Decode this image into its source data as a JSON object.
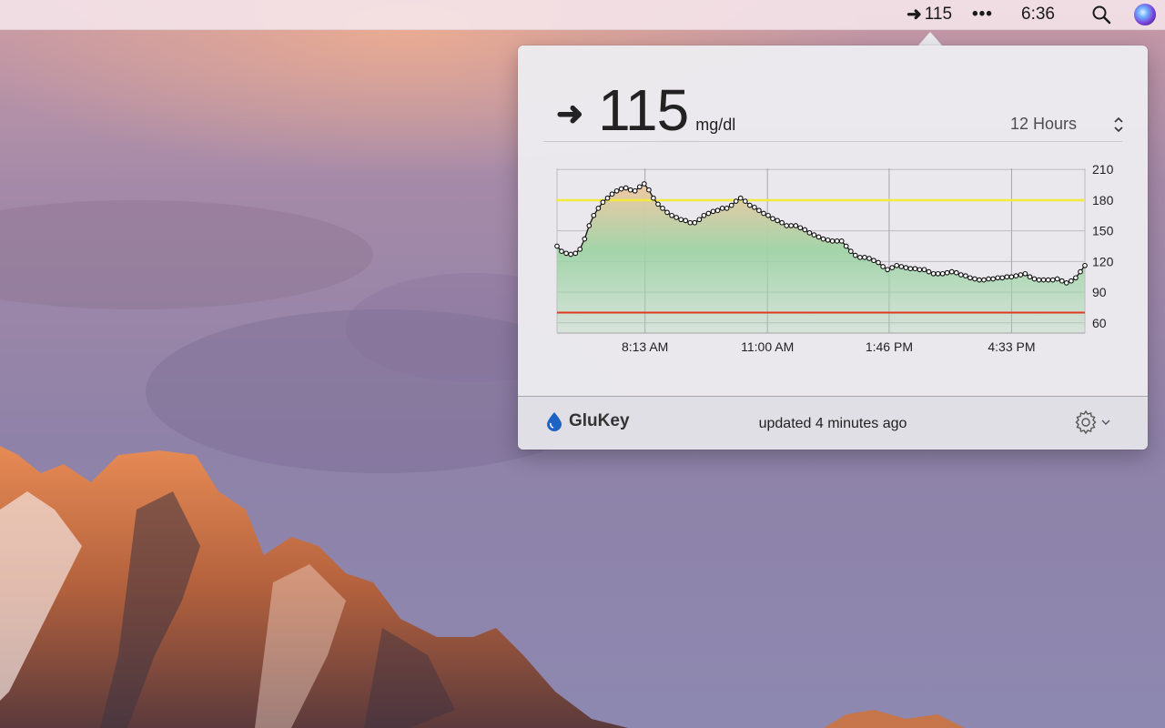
{
  "menubar": {
    "glucose_arrow": "➜",
    "glucose_value": "115",
    "more_label": "•••",
    "clock": "6:36",
    "icons": [
      "search-icon",
      "siri-icon"
    ]
  },
  "popover": {
    "trend_arrow": "➜",
    "value": "115",
    "unit": "mg/dl",
    "range_label": "12 Hours",
    "brand": "GluKey",
    "status": "updated 4 minutes ago"
  },
  "colors": {
    "high_threshold": "#f2ea3c",
    "low_threshold": "#e23a1e",
    "fill_top": "#f2c7a0",
    "fill_bottom": "#9fd3a6"
  },
  "chart_data": {
    "type": "line",
    "title": "",
    "xlabel": "",
    "ylabel": "",
    "x_ticks": [
      "8:13 AM",
      "11:00 AM",
      "1:46 PM",
      "4:33 PM"
    ],
    "y_ticks": [
      60,
      90,
      120,
      150,
      180,
      210
    ],
    "ylim": [
      50,
      220
    ],
    "x_tick_positions_minutes": [
      0,
      167,
      333,
      500
    ],
    "xlim_minutes": [
      -120,
      600
    ],
    "thresholds": {
      "high": 180,
      "low": 70
    },
    "series": [
      {
        "values": [
          135,
          130,
          128,
          127,
          128,
          132,
          142,
          155,
          165,
          172,
          178,
          182,
          186,
          189,
          191,
          192,
          190,
          189,
          193,
          196,
          190,
          182,
          176,
          172,
          168,
          165,
          163,
          161,
          160,
          158,
          158,
          161,
          165,
          167,
          169,
          170,
          172,
          172,
          175,
          179,
          182,
          179,
          175,
          173,
          170,
          167,
          165,
          162,
          160,
          158,
          155,
          155,
          155,
          153,
          151,
          148,
          146,
          144,
          142,
          141,
          140,
          140,
          140,
          135,
          130,
          126,
          124,
          124,
          123,
          121,
          119,
          115,
          112,
          114,
          116,
          115,
          114,
          113,
          113,
          112,
          112,
          110,
          108,
          108,
          108,
          109,
          110,
          109,
          107,
          106,
          104,
          103,
          102,
          102,
          103,
          103,
          104,
          104,
          105,
          105,
          106,
          107,
          108,
          105,
          103,
          102,
          102,
          102,
          102,
          103,
          101,
          99,
          101,
          104,
          110,
          116
        ]
      }
    ]
  }
}
